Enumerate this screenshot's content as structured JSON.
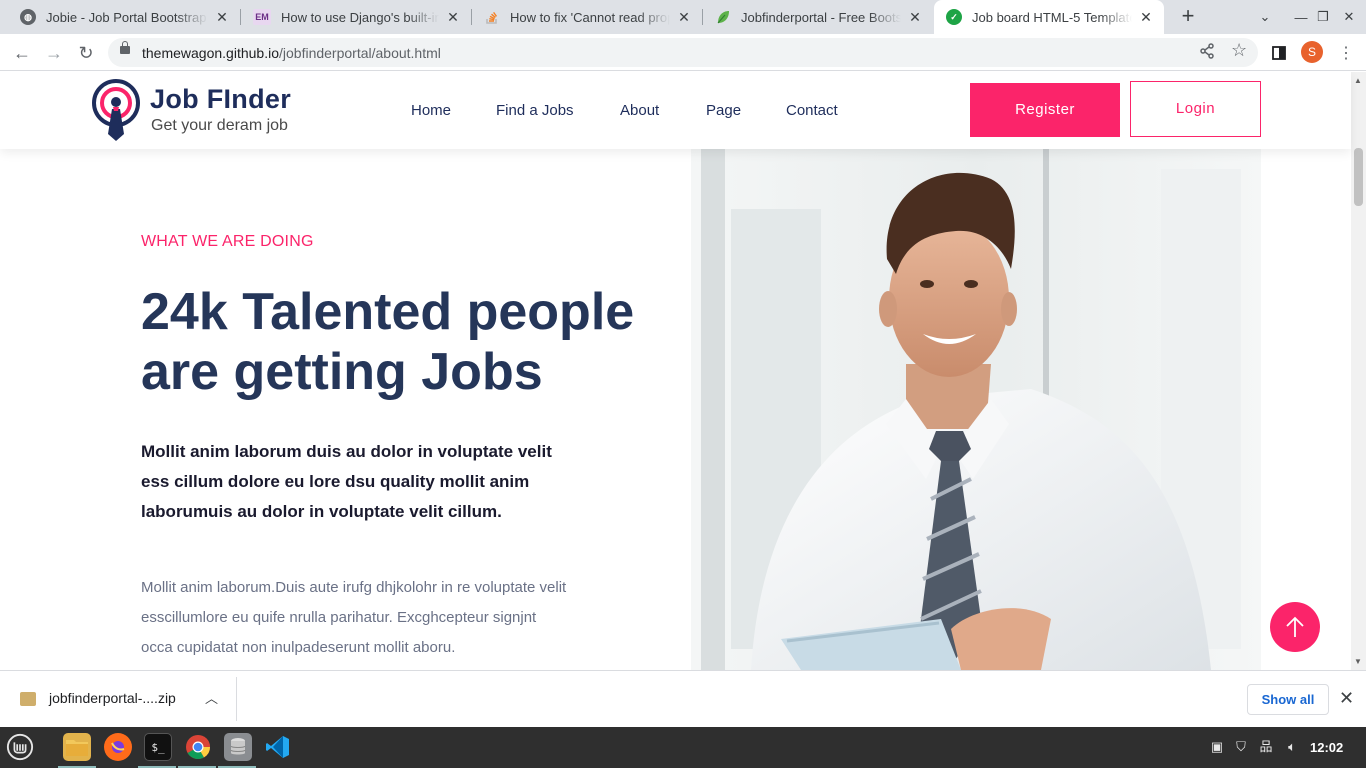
{
  "browser": {
    "tabs": [
      {
        "title": "Jobie - Job Portal Bootstrap",
        "favicon": "globe-icon"
      },
      {
        "title": "How to use Django's built-in",
        "favicon": "em-icon"
      },
      {
        "title": "How to fix 'Cannot read prop",
        "favicon": "stackoverflow-icon"
      },
      {
        "title": "Jobfinderportal - Free Boots",
        "favicon": "leaf-icon"
      },
      {
        "title": "Job board HTML-5 Template",
        "favicon": "check-icon",
        "active": true
      }
    ],
    "url_host": "themewagon.github.io",
    "url_path": "/jobfinderportal/about.html",
    "profile_initial": "S"
  },
  "site": {
    "logo_name": "Job FInder",
    "logo_tagline": "Get your deram job",
    "nav": [
      "Home",
      "Find a Jobs",
      "About",
      "Page",
      "Contact"
    ],
    "register_label": "Register",
    "login_label": "Login",
    "accent_color": "#fb246a",
    "brand_color": "#1e2d5b"
  },
  "about": {
    "eyebrow": "WHAT WE ARE DOING",
    "headline_line1": "24k Talented people",
    "headline_line2": "are getting Jobs",
    "lead": "Mollit anim laborum duis au dolor in voluptate velit ess cillum dolore eu lore dsu quality mollit anim laborumuis au dolor in voluptate velit cillum.",
    "body": "Mollit anim laborum.Duis aute irufg dhjkolohr in re voluptate velit esscillumlore eu quife nrulla parihatur. Excghcepteur signjnt occa cupidatat non inulpadeserunt mollit aboru."
  },
  "downloads": {
    "file_name": "jobfinderportal-....zip",
    "show_all_label": "Show all"
  },
  "taskbar": {
    "clock": "12:02",
    "apps": [
      "mint-menu-icon",
      "files-icon",
      "firefox-icon",
      "terminal-icon",
      "chrome-icon",
      "database-icon",
      "vscode-icon"
    ]
  }
}
